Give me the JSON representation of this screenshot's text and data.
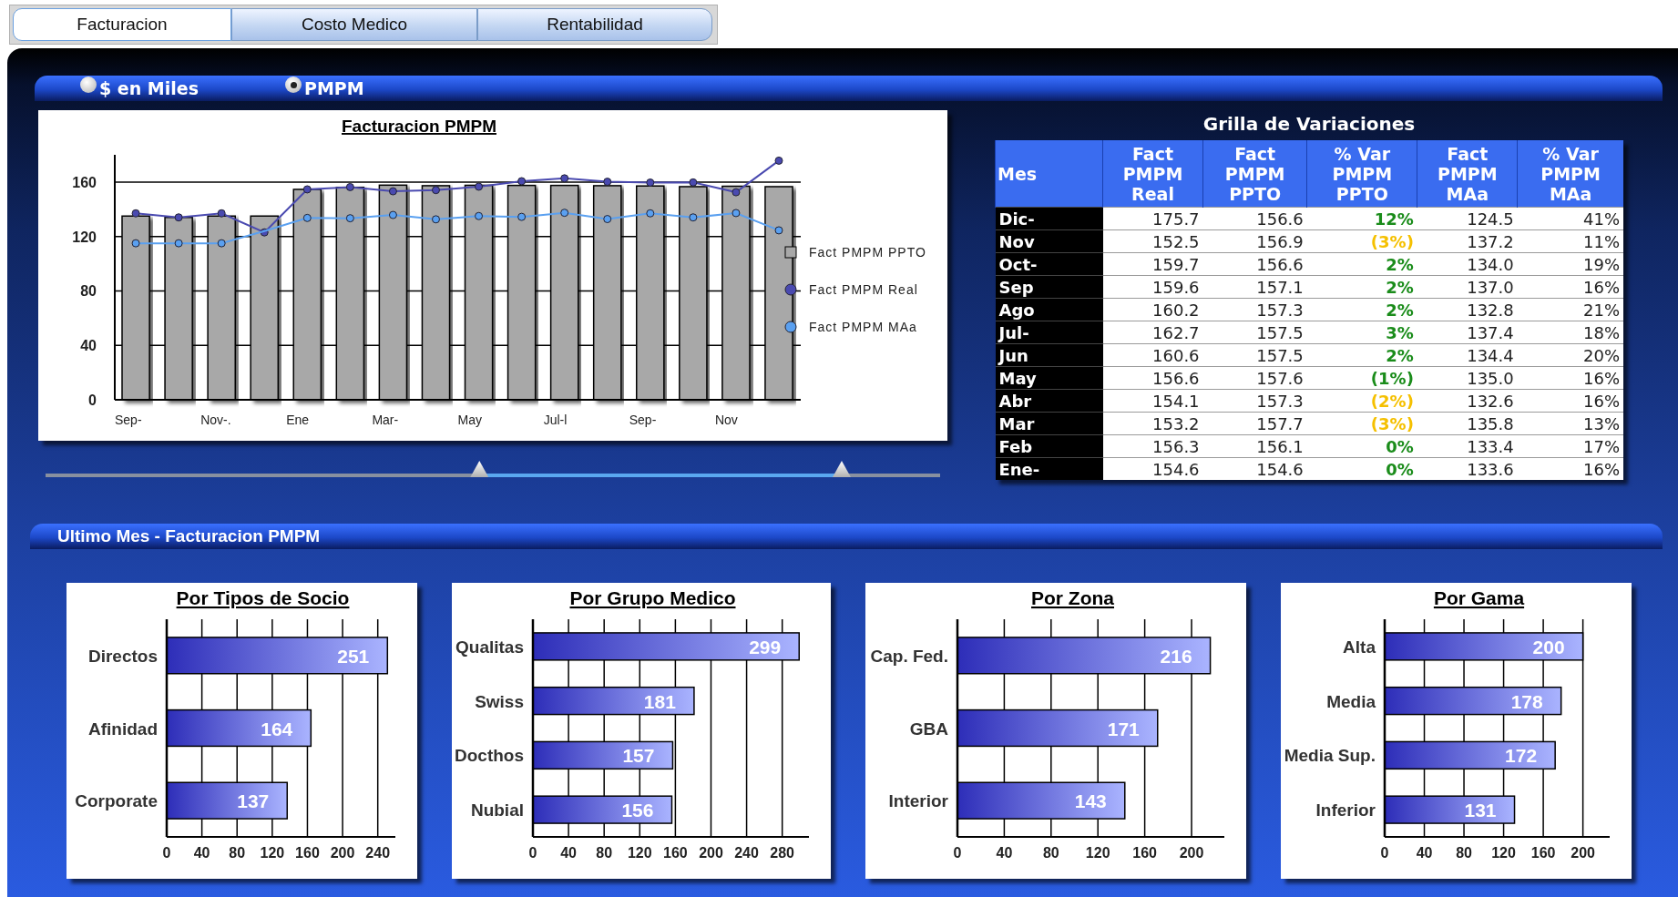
{
  "tabs": [
    {
      "label": "Facturacion",
      "selected": true
    },
    {
      "label": "Costo Medico",
      "selected": false
    },
    {
      "label": "Rentabilidad",
      "selected": false
    }
  ],
  "options": [
    {
      "label": "$ en Miles",
      "selected": false
    },
    {
      "label": "PMPM",
      "selected": true
    }
  ],
  "main_chart": {
    "chart_data": {
      "type": "bar",
      "title": "Facturacion PMPM",
      "categories": [
        "Sep-",
        null,
        "Nov-.",
        null,
        "Ene",
        null,
        "Mar-",
        null,
        "May",
        null,
        "Jul-l",
        null,
        "Sep-",
        null,
        "Nov",
        null
      ],
      "ylim": [
        0,
        180
      ],
      "yticks": [
        0,
        40,
        80,
        120,
        160
      ],
      "grid": true,
      "legend": "right",
      "series": [
        {
          "name": "Fact PMPM PPTO",
          "type": "bar",
          "color": "#a8a8a8",
          "values": [
            135,
            134,
            135,
            135,
            154.6,
            156.1,
            157.7,
            157.3,
            157.6,
            157.5,
            157.5,
            157.3,
            157.1,
            156.6,
            156.9,
            156.6
          ]
        },
        {
          "name": "Fact PMPM Real",
          "type": "line",
          "color": "#4a4ab0",
          "marker": "circle",
          "values": [
            137,
            134,
            137,
            123,
            154.6,
            156.3,
            153.2,
            154.1,
            156.6,
            160.6,
            162.7,
            160.2,
            159.6,
            159.7,
            152.5,
            175.7
          ]
        },
        {
          "name": "Fact PMPM MAa",
          "type": "line",
          "color": "#5aa0f0",
          "marker": "circle",
          "values": [
            115,
            115,
            115,
            124,
            133.6,
            133.4,
            135.8,
            132.6,
            135.0,
            134.4,
            137.4,
            132.8,
            137.0,
            134.0,
            137.2,
            124.5
          ]
        }
      ]
    }
  },
  "slider": {
    "thumbs": [
      {
        "level": 0.485
      },
      {
        "level": 0.89
      }
    ]
  },
  "table": {
    "title": "Grilla de Variaciones",
    "columns": [
      "Mes",
      "Fact PMPM Real",
      "Fact PMPM PPTO",
      "% Var PMPM PPTO",
      "Fact PMPM MAa",
      "% Var PMPM MAa"
    ],
    "rows": [
      {
        "mes": "Dic-",
        "real": "175.7",
        "ppto": "156.6",
        "var_ppto": {
          "text": "12%",
          "color": "#1a8c1a"
        },
        "maa": "124.5",
        "var_maa": "41%"
      },
      {
        "mes": "Nov",
        "real": "152.5",
        "ppto": "156.9",
        "var_ppto": {
          "text": "(3%)",
          "color": "#f5c000"
        },
        "maa": "137.2",
        "var_maa": "11%"
      },
      {
        "mes": "Oct-",
        "real": "159.7",
        "ppto": "156.6",
        "var_ppto": {
          "text": "2%",
          "color": "#1a8c1a"
        },
        "maa": "134.0",
        "var_maa": "19%"
      },
      {
        "mes": "Sep",
        "real": "159.6",
        "ppto": "157.1",
        "var_ppto": {
          "text": "2%",
          "color": "#1a8c1a"
        },
        "maa": "137.0",
        "var_maa": "16%"
      },
      {
        "mes": "Ago",
        "real": "160.2",
        "ppto": "157.3",
        "var_ppto": {
          "text": "2%",
          "color": "#1a8c1a"
        },
        "maa": "132.8",
        "var_maa": "21%"
      },
      {
        "mes": "Jul-",
        "real": "162.7",
        "ppto": "157.5",
        "var_ppto": {
          "text": "3%",
          "color": "#1a8c1a"
        },
        "maa": "137.4",
        "var_maa": "18%"
      },
      {
        "mes": "Jun",
        "real": "160.6",
        "ppto": "157.5",
        "var_ppto": {
          "text": "2%",
          "color": "#1a8c1a"
        },
        "maa": "134.4",
        "var_maa": "20%"
      },
      {
        "mes": "May",
        "real": "156.6",
        "ppto": "157.6",
        "var_ppto": {
          "text": "(1%)",
          "color": "#1a8c1a"
        },
        "maa": "135.0",
        "var_maa": "16%"
      },
      {
        "mes": "Abr",
        "real": "154.1",
        "ppto": "157.3",
        "var_ppto": {
          "text": "(2%)",
          "color": "#f5c000"
        },
        "maa": "132.6",
        "var_maa": "16%"
      },
      {
        "mes": "Mar",
        "real": "153.2",
        "ppto": "157.7",
        "var_ppto": {
          "text": "(3%)",
          "color": "#f5c000"
        },
        "maa": "135.8",
        "var_maa": "13%"
      },
      {
        "mes": "Feb",
        "real": "156.3",
        "ppto": "156.1",
        "var_ppto": {
          "text": "0%",
          "color": "#1a8c1a"
        },
        "maa": "133.4",
        "var_maa": "17%"
      },
      {
        "mes": "Ene-",
        "real": "154.6",
        "ppto": "154.6",
        "var_ppto": {
          "text": "0%",
          "color": "#1a8c1a"
        },
        "maa": "133.6",
        "var_maa": "16%"
      }
    ]
  },
  "section_title": "Ultimo Mes - Facturacion PMPM",
  "breakdowns": [
    {
      "chart_data": {
        "type": "bar",
        "orientation": "horizontal",
        "title": "Por Tipos de Socio",
        "categories": [
          "Directos",
          "Afinidad",
          "Corporate"
        ],
        "values": [
          251,
          164,
          137
        ],
        "xlim": [
          0,
          260
        ],
        "grid": true,
        "xticks": [
          0,
          40,
          80,
          120,
          160,
          200,
          240
        ],
        "data_labels": true
      }
    },
    {
      "chart_data": {
        "type": "bar",
        "orientation": "horizontal",
        "title": "Por Grupo Medico",
        "categories": [
          "Qualitas",
          "Swiss",
          "Docthos",
          "Nubial"
        ],
        "values": [
          299,
          181,
          157,
          156
        ],
        "xlim": [
          0,
          310
        ],
        "grid": true,
        "xticks": [
          0,
          40,
          80,
          120,
          160,
          200,
          240,
          280
        ],
        "data_labels": true
      }
    },
    {
      "chart_data": {
        "type": "bar",
        "orientation": "horizontal",
        "title": "Por Zona",
        "categories": [
          "Cap. Fed.",
          "GBA",
          "Interior"
        ],
        "values": [
          216,
          171,
          143
        ],
        "xlim": [
          0,
          228
        ],
        "grid": true,
        "xticks": [
          0,
          40,
          80,
          120,
          160,
          200
        ],
        "data_labels": true
      }
    },
    {
      "chart_data": {
        "type": "bar",
        "orientation": "horizontal",
        "title": "Por Gama",
        "categories": [
          "Alta",
          "Media",
          "Media Sup.",
          "Inferior"
        ],
        "values": [
          200,
          178,
          172,
          131
        ],
        "xlim": [
          0,
          227
        ],
        "grid": true,
        "xticks": [
          0,
          40,
          80,
          120,
          160,
          200
        ],
        "data_labels": true
      }
    }
  ]
}
